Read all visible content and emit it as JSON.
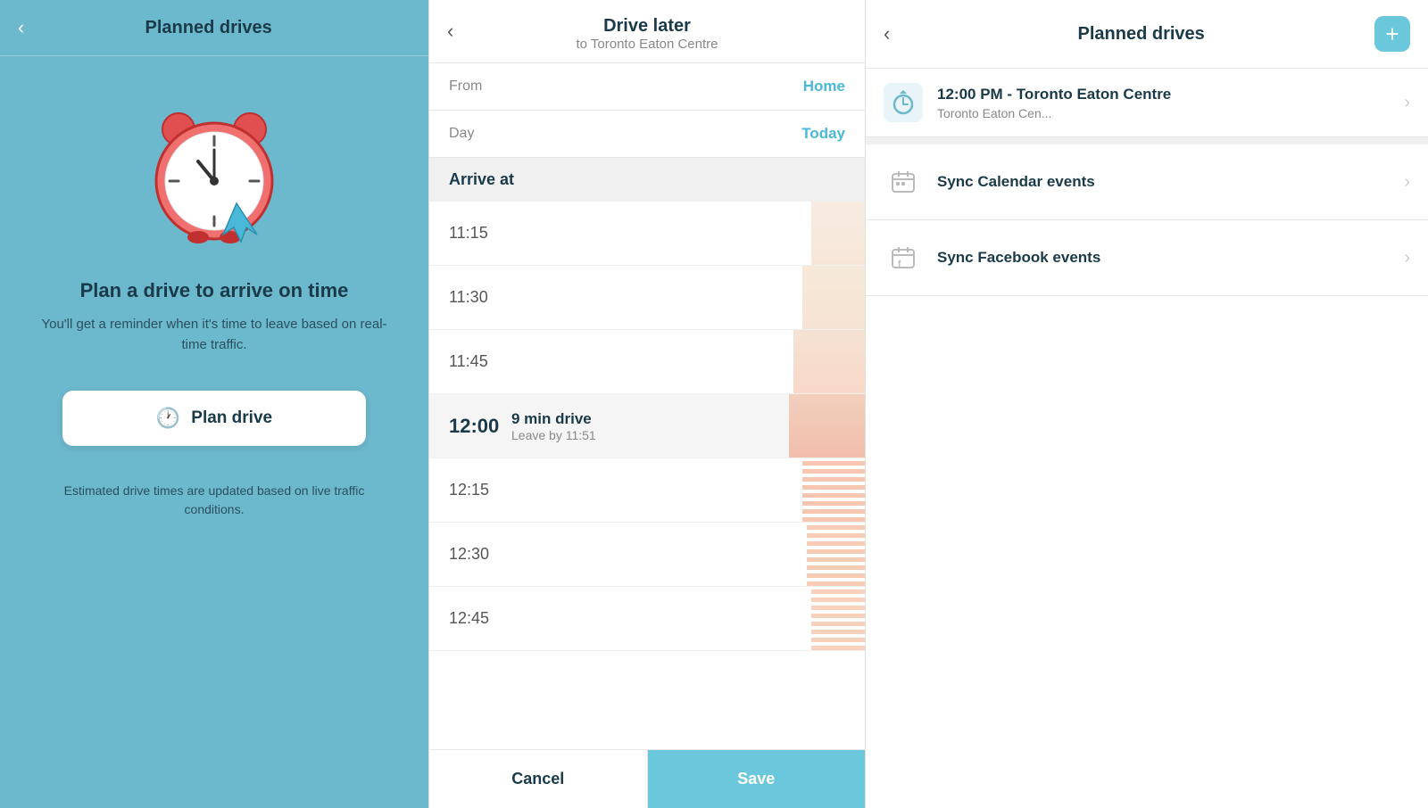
{
  "left_panel": {
    "title": "Planned drives",
    "back_label": "‹",
    "plan_title": "Plan a drive to arrive on time",
    "plan_subtitle": "You'll get a reminder when it's time to leave\nbased on real-time traffic.",
    "plan_button": "Plan drive",
    "plan_note": "Estimated drive times are updated based on live\ntraffic conditions."
  },
  "middle_panel": {
    "title": "Drive later",
    "subtitle": "to Toronto Eaton Centre",
    "back_label": "‹",
    "from_label": "From",
    "from_value": "Home",
    "day_label": "Day",
    "day_value": "Today",
    "arrive_at_label": "Arrive at",
    "times": [
      {
        "label": "11:15",
        "selected": false,
        "info": ""
      },
      {
        "label": "11:30",
        "selected": false,
        "info": ""
      },
      {
        "label": "11:45",
        "selected": false,
        "info": ""
      },
      {
        "label": "12:00",
        "selected": true,
        "drive": "9 min drive",
        "leave": "Leave by 11:51"
      },
      {
        "label": "12:15",
        "selected": false,
        "info": ""
      },
      {
        "label": "12:30",
        "selected": false,
        "info": ""
      },
      {
        "label": "12:45",
        "selected": false,
        "info": ""
      }
    ],
    "cancel_label": "Cancel",
    "save_label": "Save"
  },
  "right_panel": {
    "title": "Planned drives",
    "back_label": "‹",
    "add_label": "+",
    "drive_item": {
      "time": "12:00 PM - Toronto Eaton Centre",
      "destination": "Toronto Eaton Cen..."
    },
    "sync_calendar_label": "Sync Calendar events",
    "sync_facebook_label": "Sync Facebook events"
  }
}
